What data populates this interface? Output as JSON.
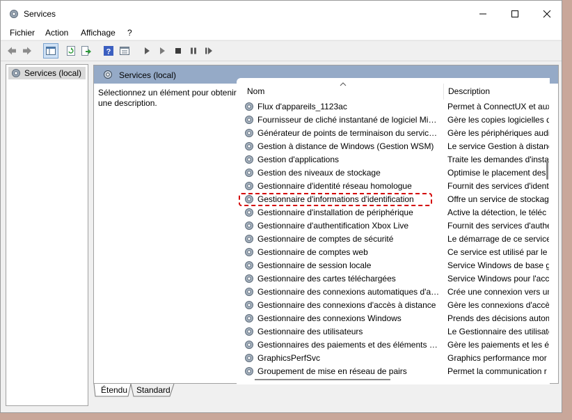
{
  "window": {
    "title": "Services",
    "controls": {
      "minimize_icon": "minimize-icon",
      "maximize_icon": "maximize-icon",
      "close_icon": "close-icon"
    }
  },
  "menubar": {
    "items": [
      "Fichier",
      "Action",
      "Affichage",
      "?"
    ]
  },
  "toolbar": {
    "icons": [
      "back-arrow-icon",
      "forward-arrow-icon",
      "console-tree-icon",
      "refresh-icon",
      "export-list-icon",
      "help-icon",
      "properties-icon",
      "play-icon",
      "play-outline-icon",
      "stop-icon",
      "pause-icon",
      "restart-icon"
    ]
  },
  "tree": {
    "selected_item": "Services (local)"
  },
  "main": {
    "header_label": "Services (local)",
    "description_prompt": "Sélectionnez un élément pour obtenir une description."
  },
  "list": {
    "columns": {
      "name": "Nom",
      "description": "Description"
    },
    "rows": [
      {
        "name": "Flux d'appareils_1123ac",
        "desc": "Permet à ConnectUX et aux"
      },
      {
        "name": "Fournisseur de cliché instantané de logiciel Micr...",
        "desc": "Gère les copies logicielles de"
      },
      {
        "name": "Générateur de points de terminaison du service ...",
        "desc": "Gère les périphériques audi"
      },
      {
        "name": "Gestion à distance de Windows (Gestion WSM)",
        "desc": "Le service Gestion à distanc"
      },
      {
        "name": "Gestion d'applications",
        "desc": "Traite les demandes d'instal"
      },
      {
        "name": "Gestion des niveaux de stockage",
        "desc": "Optimise le placement des"
      },
      {
        "name": "Gestionnaire d'identité réseau homologue",
        "desc": "Fournit des services d'ident"
      },
      {
        "name": "Gestionnaire d'informations d'identification",
        "desc": "Offre un service de stockag"
      },
      {
        "name": "Gestionnaire d'installation de périphérique",
        "desc": "Active la détection, le téléc"
      },
      {
        "name": "Gestionnaire d'authentification Xbox Live",
        "desc": "Fournit des services d'authe"
      },
      {
        "name": "Gestionnaire de comptes de sécurité",
        "desc": "Le démarrage de ce service"
      },
      {
        "name": "Gestionnaire de comptes web",
        "desc": "Ce service est utilisé par le C"
      },
      {
        "name": "Gestionnaire de session locale",
        "desc": "Service Windows de base g"
      },
      {
        "name": "Gestionnaire des cartes téléchargées",
        "desc": "Service Windows pour l'accè"
      },
      {
        "name": "Gestionnaire des connexions automatiques d'ac...",
        "desc": "Crée une connexion vers un"
      },
      {
        "name": "Gestionnaire des connexions d'accès à distance",
        "desc": "Gère les connexions d'accès"
      },
      {
        "name": "Gestionnaire des connexions Windows",
        "desc": "Prends des décisions autom"
      },
      {
        "name": "Gestionnaire des utilisateurs",
        "desc": "Le Gestionnaire des utilisate"
      },
      {
        "name": "Gestionnaires des paiements et des éléments séc...",
        "desc": "Gère les paiements et les él"
      },
      {
        "name": "GraphicsPerfSvc",
        "desc": "Graphics performance mor"
      },
      {
        "name": "Groupement de mise en réseau de pairs",
        "desc": "Permet la communication r"
      }
    ],
    "highlighted_row_index": 7
  },
  "tabs": [
    "Étendu",
    "Standard"
  ],
  "colors": {
    "header_band": "#95aac7",
    "highlight_border": "#d40000"
  }
}
